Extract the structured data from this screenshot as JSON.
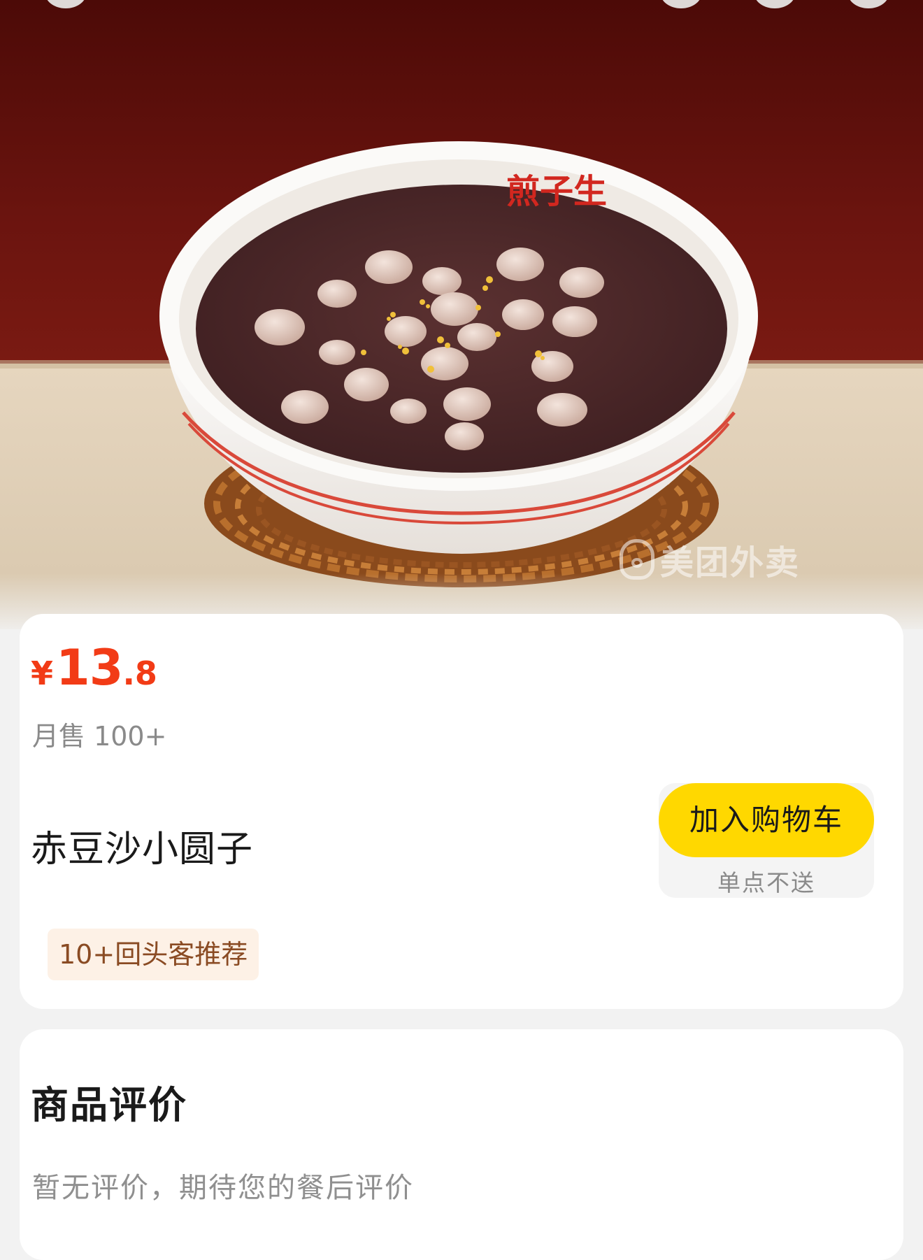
{
  "hero": {
    "image_name": "red-bean-soup-photo",
    "bowl_print": "煎子生",
    "watermark": "美团外卖"
  },
  "product": {
    "price_symbol": "¥",
    "price_integer": "13",
    "price_decimal": ".8",
    "monthly_sales": "月售 100+",
    "name": "赤豆沙小圆子",
    "add_to_cart_label": "加入购物车",
    "cart_note": "单点不送",
    "tag": "10+回头客推荐"
  },
  "reviews": {
    "title": "商品评价",
    "empty_text": "暂无评价，期待您的餐后评价"
  },
  "colors": {
    "price": "#f23b16",
    "cart_button": "#ffd800",
    "tag_bg": "#fdf1e6",
    "tag_text": "#8a4b23"
  }
}
